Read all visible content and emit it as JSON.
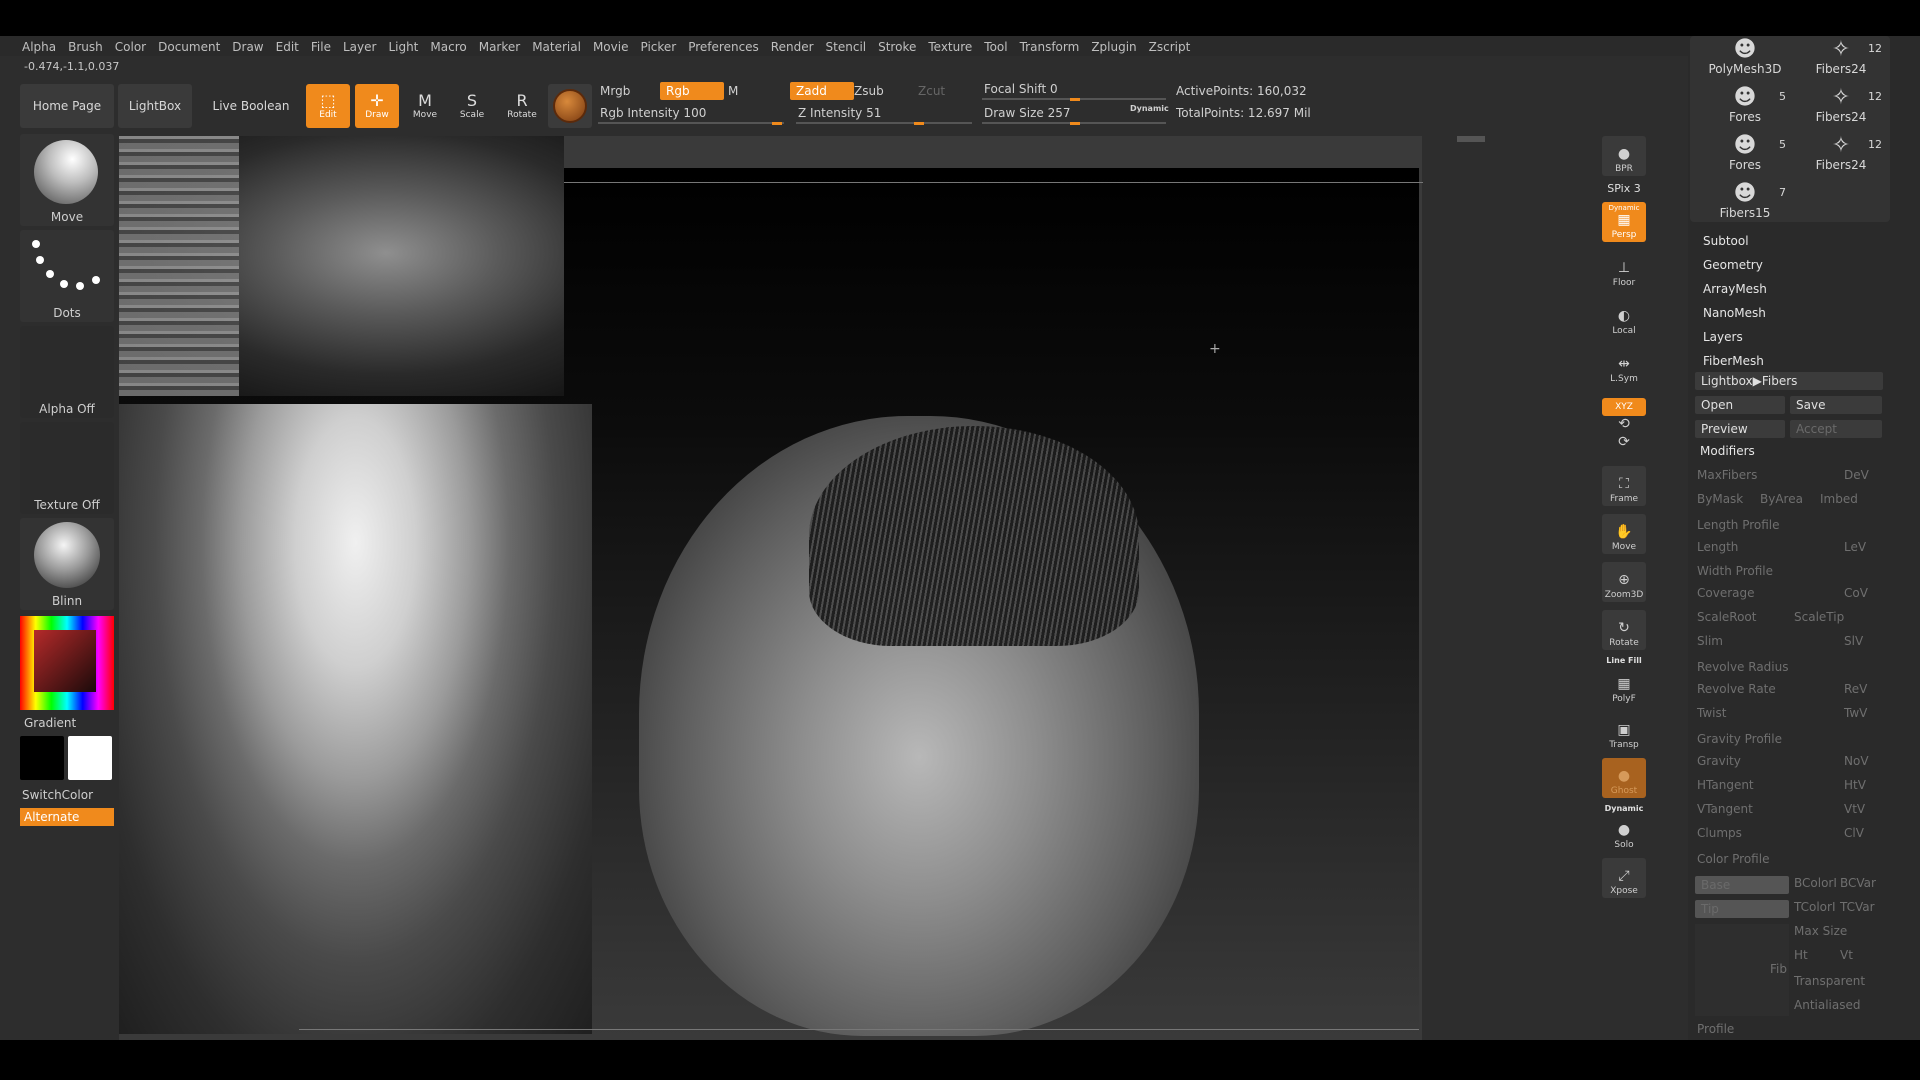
{
  "menu": [
    "Alpha",
    "Brush",
    "Color",
    "Document",
    "Draw",
    "Edit",
    "File",
    "Layer",
    "Light",
    "Macro",
    "Marker",
    "Material",
    "Movie",
    "Picker",
    "Preferences",
    "Render",
    "Stencil",
    "Stroke",
    "Texture",
    "Tool",
    "Transform",
    "Zplugin",
    "Zscript"
  ],
  "coords": "-0.474,-1.1,0.037",
  "shelf": {
    "home_page": "Home Page",
    "lightbox": "LightBox",
    "live_boolean": "Live Boolean",
    "edit": "Edit",
    "draw": "Draw",
    "move": "Move",
    "scale": "Scale",
    "rotate": "Rotate",
    "mrgb": "Mrgb",
    "rgb": "Rgb",
    "m": "M",
    "zadd": "Zadd",
    "zsub": "Zsub",
    "zcut": "Zcut",
    "rgb_intensity_label": "Rgb Intensity 100",
    "z_intensity_label": "Z Intensity 51",
    "focal_shift_label": "Focal Shift 0",
    "draw_size_label": "Draw Size 257",
    "dynamic": "Dynamic",
    "active_points": "ActivePoints: 160,032",
    "total_points": "TotalPoints: 12.697 Mil"
  },
  "left_shelf": {
    "brush": "Move",
    "stroke": "Dots",
    "alpha": "Alpha Off",
    "texture": "Texture Off",
    "material": "Blinn",
    "gradient": "Gradient",
    "switch_color": "SwitchColor",
    "alternate": "Alternate"
  },
  "right_tools": {
    "bpr": "BPR",
    "spix": "SPix 3",
    "persp_dynamic": "Dynamic",
    "persp": "Persp",
    "floor": "Floor",
    "local": "Local",
    "lsym": "L.Sym",
    "xyz": "XYZ",
    "frame": "Frame",
    "move": "Move",
    "zoom3d": "Zoom3D",
    "rotate": "Rotate",
    "line_fill": "Line Fill",
    "polyf": "PolyF",
    "transp": "Transp",
    "ghost": "Ghost",
    "solo_dynamic": "Dynamic",
    "solo": "Solo",
    "xpose": "Xpose"
  },
  "tool_palette": [
    {
      "label": "PolyMesh3D",
      "count": ""
    },
    {
      "label": "Fibers24",
      "count": "12"
    },
    {
      "label": "Fores",
      "count": "5"
    },
    {
      "label": "Fibers24",
      "count": "12"
    },
    {
      "label": "Fores",
      "count": "5"
    },
    {
      "label": "Fibers24",
      "count": "12"
    },
    {
      "label": "Fibers15",
      "count": "7"
    }
  ],
  "panel": {
    "subtool": "Subtool",
    "geometry": "Geometry",
    "arraymesh": "ArrayMesh",
    "nanomesh": "NanoMesh",
    "layers": "Layers",
    "fibermesh": "FiberMesh",
    "lightbox_fibers": "Lightbox▶Fibers",
    "open": "Open",
    "save": "Save",
    "preview": "Preview",
    "accept": "Accept",
    "modifiers": "Modifiers",
    "maxfibers": "MaxFibers",
    "dev": "DeV",
    "bymask": "ByMask",
    "byarea": "ByArea",
    "imbed": "Imbed",
    "length_profile": "Length Profile",
    "length": "Length",
    "lev": "LeV",
    "width_profile": "Width Profile",
    "coverage": "Coverage",
    "cov": "CoV",
    "scaleroot": "ScaleRoot",
    "scaletip": "ScaleTip",
    "slim": "Slim",
    "slv": "SlV",
    "revolve_radius": "Revolve Radius",
    "revolve_rate": "Revolve Rate",
    "rev": "ReV",
    "twist": "Twist",
    "twv": "TwV",
    "gravity_profile": "Gravity Profile",
    "gravity": "Gravity",
    "nov": "NoV",
    "htangent": "HTangent",
    "htv": "HtV",
    "vtangent": "VTangent",
    "vtv": "VtV",
    "clumps": "Clumps",
    "clv": "ClV",
    "color_profile": "Color Profile",
    "base": "Base",
    "tip": "Tip",
    "bcolori": "BColorI",
    "bcvar": "BCVar",
    "tcolori": "TColorI",
    "tcvar": "TCVar",
    "max_size": "Max Size",
    "ht": "Ht",
    "vt": "Vt",
    "fib": "Fib",
    "transparent": "Transparent",
    "antialiased": "Antialiased",
    "profile": "Profile"
  },
  "colors": {
    "accent": "#f08a1c",
    "bg": "#2d2d2d"
  }
}
